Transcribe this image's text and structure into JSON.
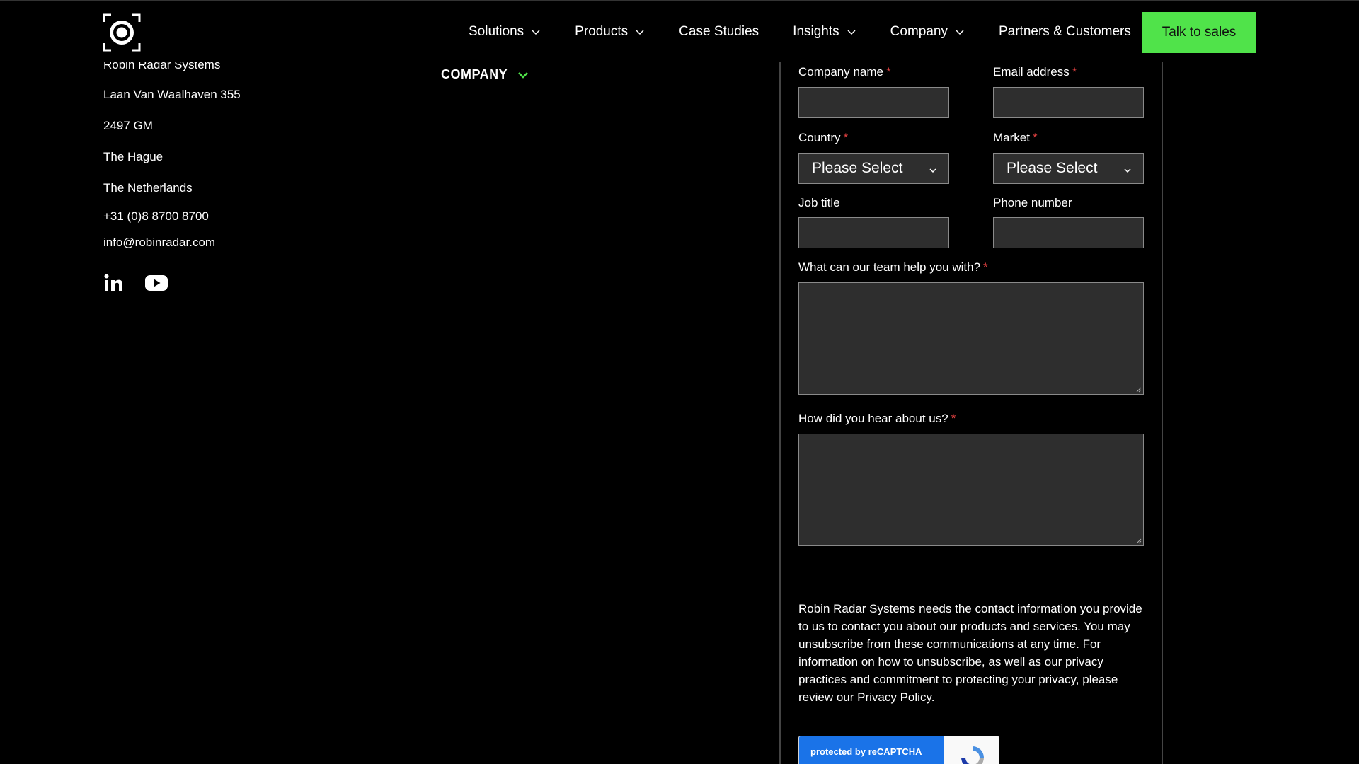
{
  "header": {
    "nav": [
      {
        "label": "Solutions",
        "has_dropdown": true
      },
      {
        "label": "Products",
        "has_dropdown": true
      },
      {
        "label": "Case Studies",
        "has_dropdown": false
      },
      {
        "label": "Insights",
        "has_dropdown": true
      },
      {
        "label": "Company",
        "has_dropdown": true
      },
      {
        "label": "Partners & Customers",
        "has_dropdown": false
      }
    ],
    "cta_label": "Talk to sales",
    "cta_color": "#50e34a",
    "logo_icon": "robin-radar-logo-icon"
  },
  "contact": {
    "company_name": "Robin Radar Systems",
    "street": "Laan Van Waalhaven 355",
    "postcode": "2497 GM",
    "city": "The Hague",
    "country": "The Netherlands",
    "phone": "+31 (0)8 8700 8700",
    "email": "info@robinradar.com",
    "social_icons": [
      "linkedin-icon",
      "youtube-icon"
    ]
  },
  "footer_menu": {
    "company_label": "COMPANY",
    "accent_color": "#50e34a"
  },
  "form": {
    "company_name_label": "Company name",
    "email_label": "Email address",
    "country_label": "Country",
    "country_value": "Please Select",
    "market_label": "Market",
    "market_value": "Please Select",
    "job_title_label": "Job title",
    "phone_label": "Phone number",
    "help_label": "What can our team help you with?",
    "hear_label": "How did you hear about us?",
    "required_marker": "*",
    "legal_text": "Robin Radar Systems needs the contact information you provide to us to contact you about our products and services. You may unsubscribe from these communications at any time. For information on how to unsubscribe, as well as our privacy practices and commitment to protecting your privacy, please review our ",
    "privacy_link": "Privacy Policy",
    "legal_end": ".",
    "recaptcha_text": "protected by reCAPTCHA"
  }
}
